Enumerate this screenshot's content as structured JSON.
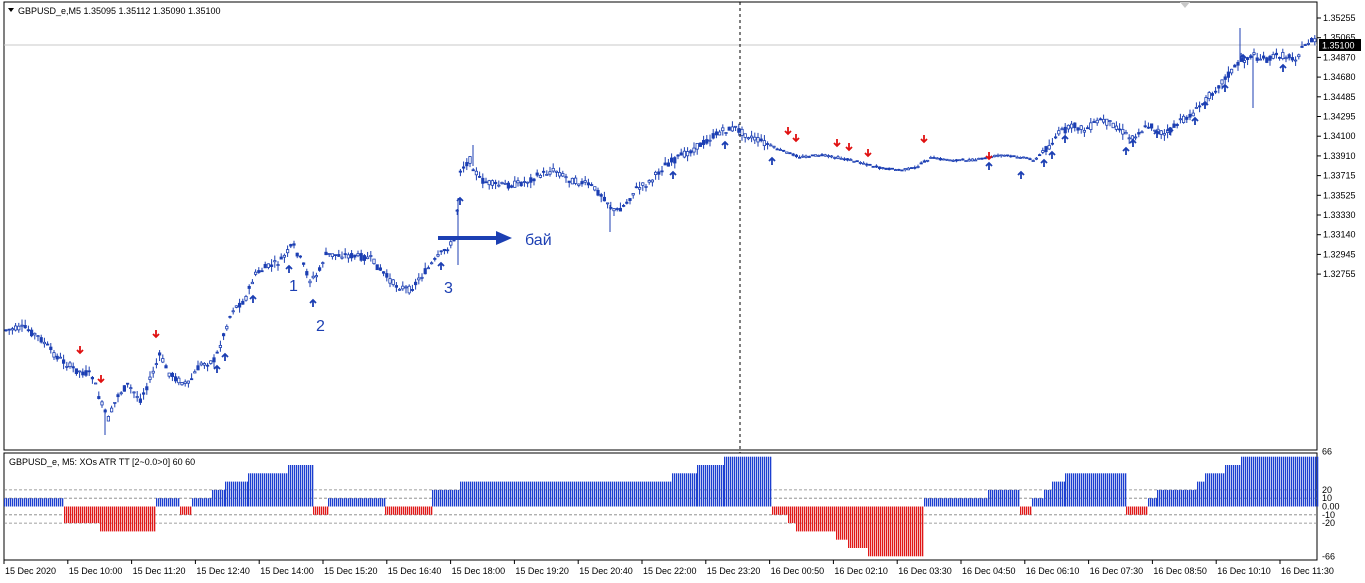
{
  "main_chart": {
    "header": "GBPUSD_e,M5  1.35095 1.35112 1.35090 1.35100",
    "price_levels": [
      "1.35255",
      "1.35065",
      "1.34870",
      "1.34680",
      "1.34485",
      "1.34295",
      "1.34100",
      "1.33910",
      "1.33715",
      "1.33525",
      "1.33330",
      "1.33140",
      "1.32945",
      "1.32755"
    ],
    "current_price": "1.35100",
    "annotations": {
      "label_1": "1",
      "label_2": "2",
      "label_3": "3",
      "buy_label": "бай"
    }
  },
  "indicator": {
    "header": "GBPUSD_e, M5: XOs ATR TT [2~0.0>0]  60 60",
    "levels": [
      "66",
      "20",
      "10",
      "0.00",
      "-10",
      "-20",
      "-66"
    ]
  },
  "time_axis": [
    "15 Dec 2020",
    "15 Dec 10:00",
    "15 Dec 11:20",
    "15 Dec 12:40",
    "15 Dec 14:00",
    "15 Dec 15:20",
    "15 Dec 16:40",
    "15 Dec 18:00",
    "15 Dec 19:20",
    "15 Dec 20:40",
    "15 Dec 22:00",
    "15 Dec 23:20",
    "16 Dec 00:50",
    "16 Dec 02:10",
    "16 Dec 03:30",
    "16 Dec 04:50",
    "16 Dec 06:10",
    "16 Dec 07:30",
    "16 Dec 08:50",
    "16 Dec 10:10",
    "16 Dec 11:30"
  ],
  "colors": {
    "candle": "#1c3fb3",
    "up_arrow": "#1c3fb3",
    "down_arrow": "#e01010",
    "bar_pos": "#1c3fd0",
    "bar_neg": "#e01818",
    "price_tag_bg": "#000000"
  }
}
